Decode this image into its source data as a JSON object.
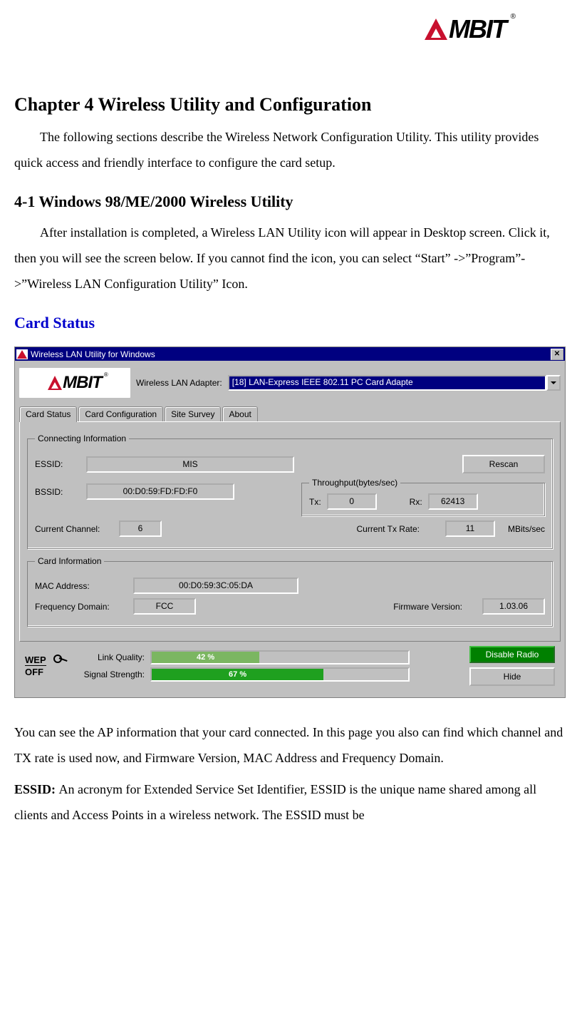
{
  "logo": {
    "text": "MBIT",
    "reg": "®"
  },
  "doc": {
    "chapter_title": "Chapter 4     Wireless Utility and Configuration",
    "intro": "The following sections describe the Wireless Network Configuration Utility. This utility provides quick access and friendly interface to configure the card setup.",
    "section_4_1": "4-1 Windows 98/ME/2000 Wireless Utility",
    "section_4_1_body": "After installation is completed, a Wireless LAN Utility icon will appear in Desktop screen. Click it, then you will see the screen below. If you cannot find the icon, you can select “Start” ->”Program”->”Wireless LAN Configuration Utility” Icon.",
    "card_status": "Card Status",
    "after_screenshot": "You can see the AP information that your card connected. In this page you also can find which channel and TX rate is used now, and  Firmware Version, MAC Address and Frequency Domain.",
    "essid_bold": "ESSID: ",
    "essid_text": "An acronym for Extended Service Set Identifier, ESSID is the unique name shared among all clients and Access Points in a wireless network. The ESSID must be"
  },
  "window": {
    "title": "Wireless LAN Utility for Windows",
    "adapter_label": "Wireless LAN Adapter:",
    "adapter_value": "[18] LAN-Express IEEE 802.11 PC Card Adapte",
    "tabs": [
      "Card Status",
      "Card Configuration",
      "Site Survey",
      "About"
    ],
    "active_tab": 0,
    "connecting_info": {
      "legend": "Connecting Information",
      "essid_label": "ESSID:",
      "essid_value": "MIS",
      "rescan": "Rescan",
      "bssid_label": "BSSID:",
      "bssid_value": "00:D0:59:FD:FD:F0",
      "throughput_legend": "Throughput(bytes/sec)",
      "tx_label": "Tx:",
      "tx_value": "0",
      "rx_label": "Rx:",
      "rx_value": "62413",
      "channel_label": "Current Channel:",
      "channel_value": "6",
      "txrate_label": "Current Tx Rate:",
      "txrate_value": "11",
      "txrate_unit": "MBits/sec"
    },
    "card_info": {
      "legend": "Card Information",
      "mac_label": "MAC Address:",
      "mac_value": "00:D0:59:3C:05:DA",
      "freq_label": "Frequency Domain:",
      "freq_value": "FCC",
      "fw_label": "Firmware Version:",
      "fw_value": "1.03.06"
    },
    "bottom": {
      "wep": "WEP",
      "wep_state": "OFF",
      "link_quality_label": "Link Quality:",
      "link_quality_pct": 42,
      "link_quality_text": "42 %",
      "link_quality_color": "#7bb661",
      "signal_label": "Signal Strength:",
      "signal_pct": 67,
      "signal_text": "67 %",
      "signal_color": "#1fa01f",
      "disable_radio": "Disable Radio",
      "hide": "Hide"
    }
  }
}
